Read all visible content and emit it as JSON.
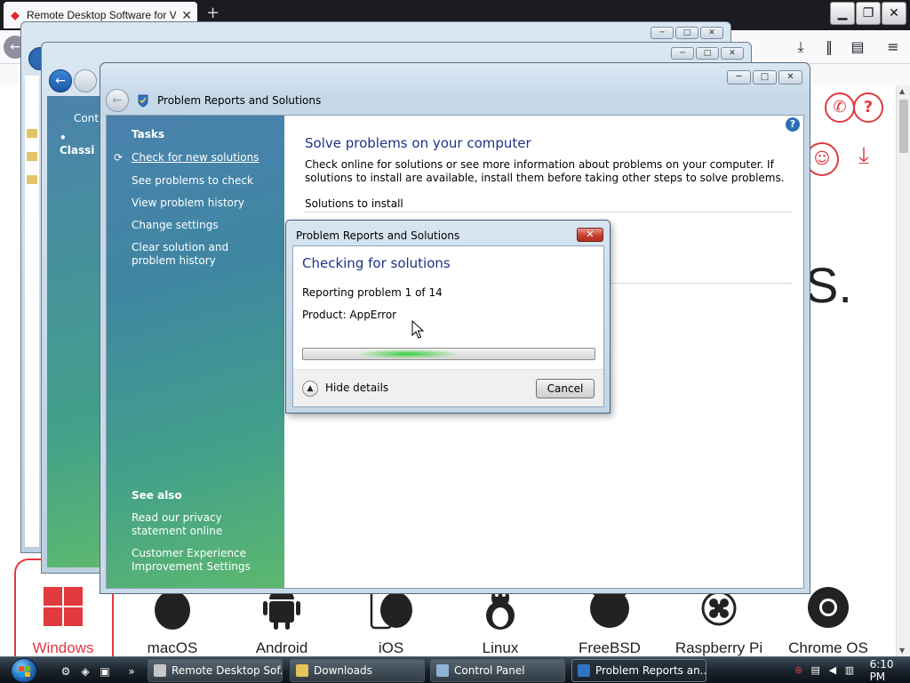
{
  "browser": {
    "tab_title": "Remote Desktop Software for V",
    "new_tab_label": "+",
    "window_controls": {
      "minimize": "▁",
      "restore": "❐",
      "close": "✕"
    }
  },
  "site": {
    "big_letter": "S.",
    "platforms": [
      "Windows",
      "macOS",
      "Android",
      "iOS",
      "Linux",
      "FreeBSD",
      "Raspberry Pi",
      "Chrome OS"
    ]
  },
  "bg_windows": {
    "nav_partial_1": "Contr",
    "nav_partial_2": "Classi"
  },
  "main_window": {
    "title": "Problem Reports and Solutions",
    "controls": {
      "minimize": "─",
      "maximize": "□",
      "close": "✕"
    },
    "tasks_heading": "Tasks",
    "tasks": [
      "Check for new solutions",
      "See problems to check",
      "View problem history",
      "Change settings",
      "Clear solution and problem history"
    ],
    "see_also_heading": "See also",
    "see_also": [
      "Read our privacy statement online",
      "Customer Experience Improvement Settings"
    ],
    "heading": "Solve problems on your computer",
    "description": "Check online for solutions or see more information about problems on your computer. If solutions to install are available, install them before taking other steps to solve problems.",
    "solutions_heading": "Solutions to install",
    "help_label": "?"
  },
  "dialog": {
    "title": "Problem Reports and Solutions",
    "close_label": "✕",
    "heading": "Checking for solutions",
    "line1": "Reporting problem 1 of 14",
    "line2": "Product: AppError",
    "progress_state": "indeterminate",
    "hide_details": "Hide details",
    "cancel": "Cancel"
  },
  "taskbar": {
    "tasks": [
      {
        "label": "Remote Desktop Sof...",
        "active": false
      },
      {
        "label": "Downloads",
        "active": false
      },
      {
        "label": "Control Panel",
        "active": false
      },
      {
        "label": "Problem Reports an...",
        "active": true
      }
    ],
    "quicklaunch_more": "»",
    "clock": "6:10 PM"
  },
  "colors": {
    "accent_red": "#e0393e",
    "vista_heading_blue": "#1e3287",
    "task_pane_top": "#4a82ad",
    "task_pane_bottom": "#5cb86f",
    "progress_green": "#33d23d"
  }
}
